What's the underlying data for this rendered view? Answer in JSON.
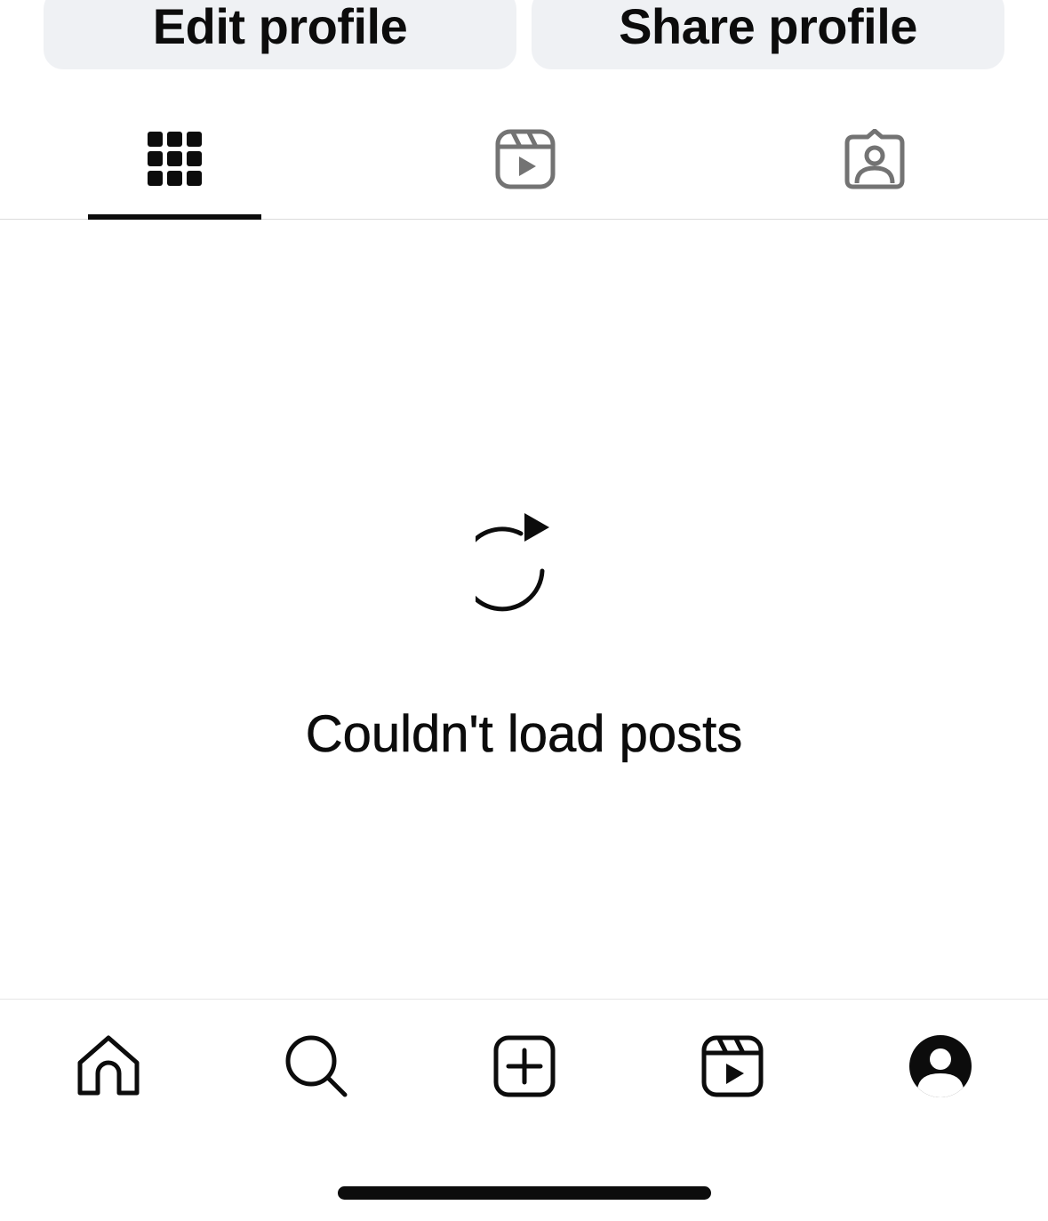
{
  "actions": {
    "edit_label": "Edit profile",
    "share_label": "Share profile"
  },
  "tabs": [
    {
      "id": "posts",
      "icon": "grid-icon",
      "active": true
    },
    {
      "id": "reels",
      "icon": "reels-icon",
      "active": false
    },
    {
      "id": "tagged",
      "icon": "tagged-person-icon",
      "active": false
    }
  ],
  "empty_state": {
    "icon": "refresh-icon",
    "message": "Couldn't load posts"
  },
  "bottom_nav": [
    {
      "id": "home",
      "icon": "home-icon"
    },
    {
      "id": "search",
      "icon": "search-icon"
    },
    {
      "id": "create",
      "icon": "create-plus-icon"
    },
    {
      "id": "reels",
      "icon": "reels-icon"
    },
    {
      "id": "profile",
      "icon": "profile-avatar-icon"
    }
  ],
  "colors": {
    "text": "#0c0c0c",
    "button_bg": "#eff1f4",
    "inactive_icon": "#737373",
    "divider": "#dbdbdb"
  }
}
